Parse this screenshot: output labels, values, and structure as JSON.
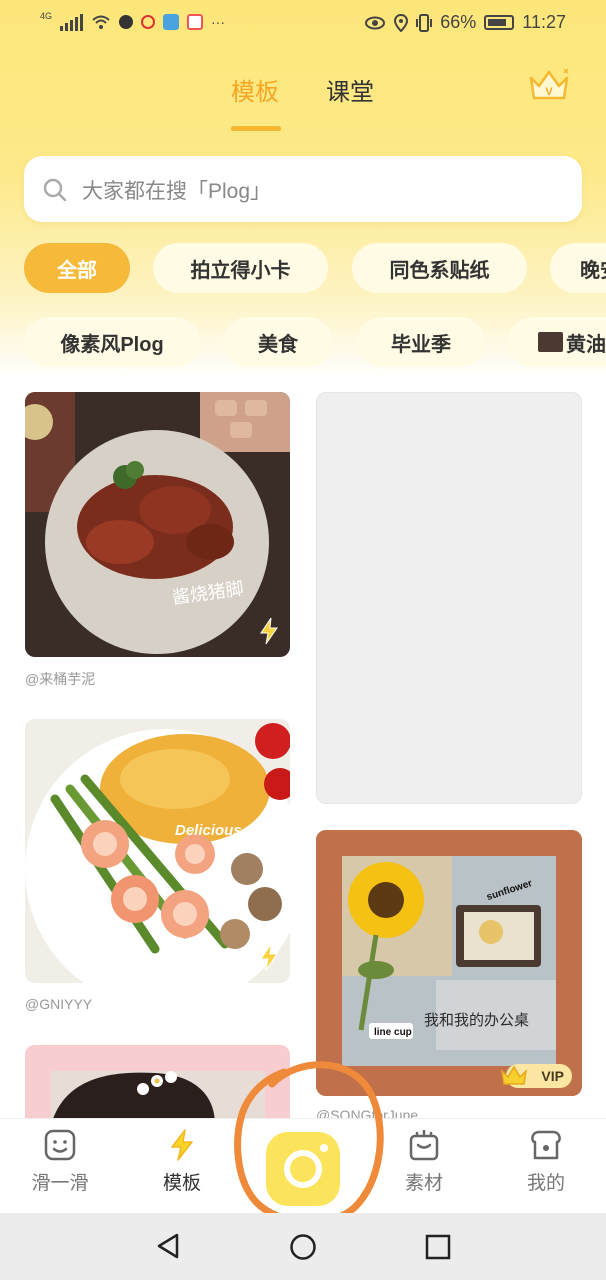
{
  "status_bar": {
    "network": "4G",
    "battery_percent": "66%",
    "time": "11:27",
    "more": "···"
  },
  "header": {
    "tabs": [
      {
        "label": "模板",
        "active": true
      },
      {
        "label": "课堂",
        "active": false
      }
    ],
    "vip_icon": "crown-v-icon",
    "accent_color": "#f5a623"
  },
  "search": {
    "placeholder": "大家都在搜「Plog」"
  },
  "categories": {
    "row1": [
      "全部",
      "拍立得小卡",
      "同色系贴纸",
      "晚安"
    ],
    "row2": [
      "像素风Plog",
      "美食",
      "毕业季",
      "黄油"
    ]
  },
  "feed": {
    "cards": [
      {
        "author": "@来桶芋泥",
        "caption": "酱烧猪脚"
      },
      {
        "author": "@GNIYYY",
        "caption": "Delicious."
      },
      {
        "author": "@SONGforJune",
        "caption": "我和我的办公桌",
        "labels": [
          "sunflower",
          "line cup"
        ],
        "badge": "VIP"
      }
    ]
  },
  "bottom_nav": {
    "items": [
      {
        "label": "滑一滑",
        "icon": "smile-face-icon"
      },
      {
        "label": "模板",
        "icon": "lightning-icon",
        "active": true
      },
      {
        "label": "",
        "icon": "camera-icon"
      },
      {
        "label": "素材",
        "icon": "bag-icon"
      },
      {
        "label": "我的",
        "icon": "toast-profile-icon"
      }
    ]
  },
  "colors": {
    "header_yellow": "#fde77a",
    "chip_active": "#f6b93a",
    "camera_yellow": "#fbe35b",
    "annotation_orange": "#ef8a3a"
  }
}
